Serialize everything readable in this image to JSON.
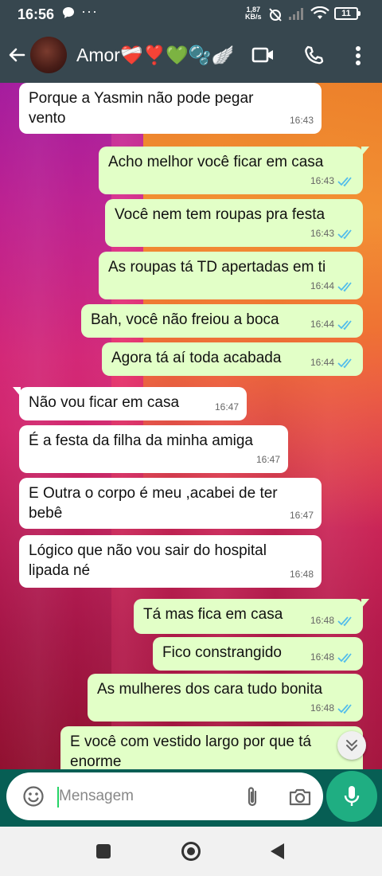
{
  "status_bar": {
    "time": "16:56",
    "notification_icons": [
      "message-icon",
      "more-dots-icon"
    ],
    "dots": "···",
    "speed_value": "1,87",
    "speed_unit": "KB/s",
    "battery": "11"
  },
  "header": {
    "contact_name": "Amor❤️‍🩹❣️💚🫧🪽",
    "icons": [
      "back-arrow-icon",
      "video-call-icon",
      "voice-call-icon",
      "more-vert-icon"
    ]
  },
  "messages": [
    {
      "dir": "in",
      "text_lines": [
        "Porque a Yasmin não pode pegar",
        "vento"
      ],
      "time": "16:43"
    },
    {
      "dir": "out",
      "text_lines": [
        "Acho melhor você ficar em casa"
      ],
      "time": "16:43",
      "status": "read"
    },
    {
      "dir": "out",
      "text_lines": [
        "Você nem tem roupas pra festa"
      ],
      "time": "16:43",
      "status": "read"
    },
    {
      "dir": "out",
      "text_lines": [
        "As roupas tá TD apertadas em ti"
      ],
      "time": "16:44",
      "status": "read"
    },
    {
      "dir": "out",
      "text_lines": [
        "Bah, você não freiou a boca"
      ],
      "time": "16:44",
      "status": "read"
    },
    {
      "dir": "out",
      "text_lines": [
        "Agora tá aí toda acabada"
      ],
      "time": "16:44",
      "status": "read"
    },
    {
      "dir": "in",
      "text_lines": [
        "Não vou ficar em casa"
      ],
      "time": "16:47"
    },
    {
      "dir": "in",
      "text_lines": [
        "É a festa da filha da minha amiga"
      ],
      "time": "16:47"
    },
    {
      "dir": "in",
      "text_lines": [
        "E Outra o corpo é meu ,acabei de ter",
        "bebê"
      ],
      "time": "16:47"
    },
    {
      "dir": "in",
      "text_lines": [
        "Lógico que não vou sair do hospital",
        "lipada né"
      ],
      "time": "16:48"
    },
    {
      "dir": "out",
      "text_lines": [
        "Tá mas fica em casa"
      ],
      "time": "16:48",
      "status": "read"
    },
    {
      "dir": "out",
      "text_lines": [
        "Fico constrangido"
      ],
      "time": "16:48",
      "status": "read"
    },
    {
      "dir": "out",
      "text_lines": [
        "As mulheres dos cara tudo bonita"
      ],
      "time": "16:48",
      "status": "read"
    },
    {
      "dir": "out",
      "text_lines": [
        "E você com vestido largo por que tá",
        "enorme"
      ],
      "time": "",
      "status": "read"
    }
  ],
  "composer": {
    "placeholder": "Mensagem",
    "icons": [
      "emoji-icon",
      "attach-icon",
      "camera-icon",
      "mic-icon"
    ]
  },
  "colors": {
    "header_bg": "#37474f",
    "bubble_out": "#e2ffc7",
    "bubble_in": "#ffffff",
    "mic_button": "#1fae82",
    "read_ticks": "#53bdeb"
  }
}
